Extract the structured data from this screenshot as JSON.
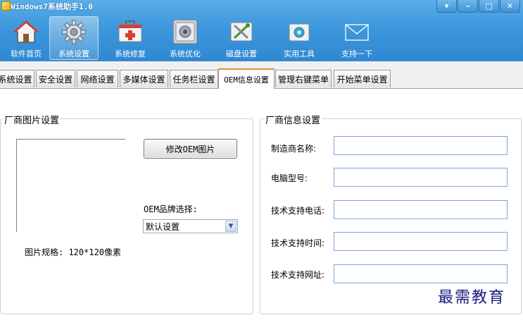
{
  "window": {
    "title": "Windows7系统助手1.0",
    "controls": [
      "▾",
      "–",
      "□",
      "✕"
    ]
  },
  "toolbar": {
    "items": [
      {
        "label": "软件首页",
        "icon": "home-icon"
      },
      {
        "label": "系统设置",
        "icon": "gear-icon",
        "active": true
      },
      {
        "label": "系统修复",
        "icon": "first-aid-kit-icon"
      },
      {
        "label": "系统优化",
        "icon": "optimize-icon"
      },
      {
        "label": "磁盘设置",
        "icon": "disk-tools-icon"
      },
      {
        "label": "实用工具",
        "icon": "toolbox-icon"
      },
      {
        "label": "支持一下",
        "icon": "envelope-icon"
      }
    ]
  },
  "tabs": [
    {
      "label": "系统设置"
    },
    {
      "label": "安全设置"
    },
    {
      "label": "网络设置"
    },
    {
      "label": "多媒体设置"
    },
    {
      "label": "任务栏设置"
    },
    {
      "label": "OEM信息设置",
      "active": true
    },
    {
      "label": "管理右键菜单"
    },
    {
      "label": "开始菜单设置"
    }
  ],
  "oem_image": {
    "legend": "厂商图片设置",
    "modify_button": "修改OEM图片",
    "brand_label": "OEM品牌选择:",
    "brand_selected": "默认设置",
    "spec_text": "图片规格: 120*120像素"
  },
  "vendor_info": {
    "legend": "厂商信息设置",
    "fields": [
      {
        "label": "制造商名称:",
        "value": ""
      },
      {
        "label": "电脑型号:",
        "value": ""
      },
      {
        "label": "技术支持电话:",
        "value": ""
      },
      {
        "label": "技术支持时间:",
        "value": ""
      },
      {
        "label": "技术支持网址:",
        "value": ""
      }
    ]
  },
  "watermark": "最需教育",
  "colors": {
    "header_blue": "#3d97dc",
    "active_tab_accent": "#e68b2c",
    "field_border": "#7aa7d8"
  }
}
